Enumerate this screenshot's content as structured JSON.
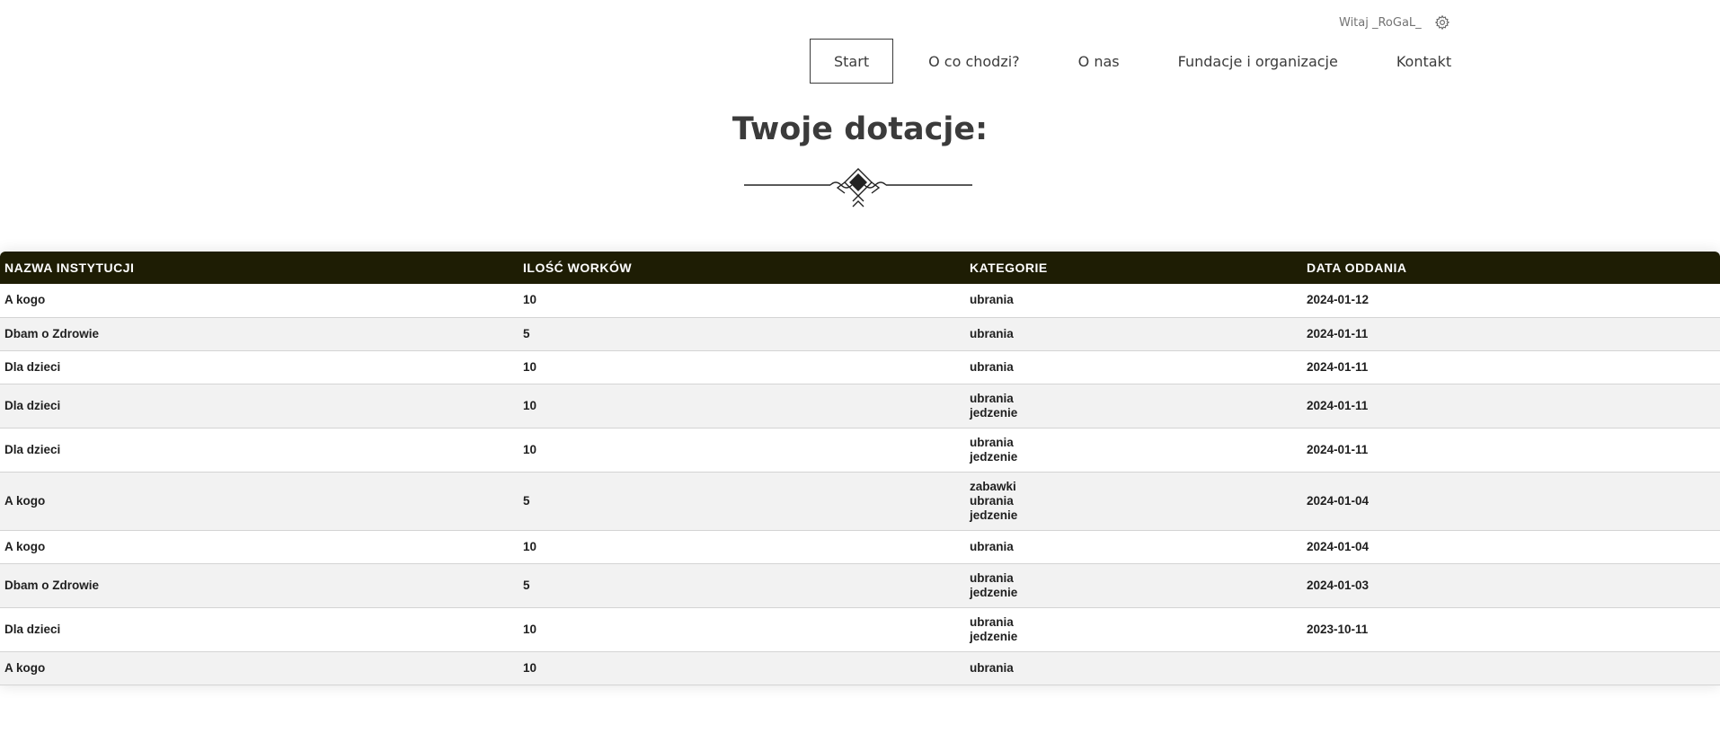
{
  "user": {
    "greeting": "Witaj _RoGaL_",
    "settings_icon": "gear-icon"
  },
  "nav": {
    "items": [
      {
        "label": "Start",
        "active": true
      },
      {
        "label": "O co chodzi?",
        "active": false
      },
      {
        "label": "O nas",
        "active": false
      },
      {
        "label": "Fundacje i organizacje",
        "active": false
      },
      {
        "label": "Kontakt",
        "active": false
      }
    ]
  },
  "page": {
    "title": "Twoje dotacje:",
    "ornament_icon": "decorative-ornament-icon"
  },
  "table": {
    "headers": [
      "NAZWA INSTYTUCJI",
      "ILOŚĆ WORKÓW",
      "KATEGORIE",
      "DATA ODDANIA"
    ],
    "rows": [
      {
        "institution": "A kogo",
        "bags": "10",
        "categories": [
          "ubrania"
        ],
        "date": "2024-01-12"
      },
      {
        "institution": "Dbam o Zdrowie",
        "bags": "5",
        "categories": [
          "ubrania"
        ],
        "date": "2024-01-11"
      },
      {
        "institution": "Dla dzieci",
        "bags": "10",
        "categories": [
          "ubrania"
        ],
        "date": "2024-01-11"
      },
      {
        "institution": "Dla dzieci",
        "bags": "10",
        "categories": [
          "ubrania",
          "jedzenie"
        ],
        "date": "2024-01-11"
      },
      {
        "institution": "Dla dzieci",
        "bags": "10",
        "categories": [
          "ubrania",
          "jedzenie"
        ],
        "date": "2024-01-11"
      },
      {
        "institution": "A kogo",
        "bags": "5",
        "categories": [
          "zabawki",
          "ubrania",
          "jedzenie"
        ],
        "date": "2024-01-04"
      },
      {
        "institution": "A kogo",
        "bags": "10",
        "categories": [
          "ubrania"
        ],
        "date": "2024-01-04"
      },
      {
        "institution": "Dbam o Zdrowie",
        "bags": "5",
        "categories": [
          "ubrania",
          "jedzenie"
        ],
        "date": "2024-01-03"
      },
      {
        "institution": "Dla dzieci",
        "bags": "10",
        "categories": [
          "ubrania",
          "jedzenie"
        ],
        "date": "2023-10-11"
      },
      {
        "institution": "A kogo",
        "bags": "10",
        "categories": [
          "ubrania"
        ],
        "date": ""
      }
    ]
  },
  "colors": {
    "table_header_bg": "#1e1d04",
    "row_alt_bg": "#f2f2f2",
    "text": "#3b3b3b"
  }
}
